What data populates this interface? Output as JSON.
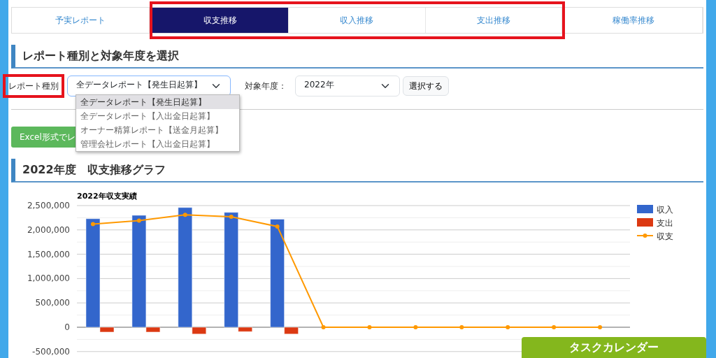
{
  "tabs": [
    {
      "label": "予実レポート",
      "selected": false,
      "highlighted": false
    },
    {
      "label": "収支推移",
      "selected": true,
      "highlighted": true
    },
    {
      "label": "収入推移",
      "selected": false,
      "highlighted": true
    },
    {
      "label": "支出推移",
      "selected": false,
      "highlighted": true
    },
    {
      "label": "稼働率推移",
      "selected": false,
      "highlighted": false
    }
  ],
  "selection_section": {
    "heading": "レポート種別と対象年度を選択",
    "report_type": {
      "label": "レポート種別",
      "highlighted": true,
      "value": "全データレポート【発生日起算】",
      "expanded": true,
      "options": [
        {
          "label": "全データレポート【発生日起算】",
          "selected": true
        },
        {
          "label": "全データレポート【入出金日起算】",
          "selected": false
        },
        {
          "label": "オーナー精算レポート【送金月起算】",
          "selected": false
        },
        {
          "label": "管理会社レポート【入出金日起算】",
          "selected": false
        }
      ]
    },
    "year": {
      "label": "対象年度：",
      "value": "2022年"
    },
    "submit_button": "選択する"
  },
  "excel_button": "Excel形式でレ",
  "graph_section": {
    "heading": "2022年度　収支推移グラフ",
    "chart_data": {
      "type": "bar",
      "title": "2022年収支実績",
      "grid": true,
      "legend": true,
      "series": [
        {
          "name": "収入",
          "color": "#3366cc",
          "type": "bar",
          "values": [
            2230000,
            2300000,
            2460000,
            2360000,
            2220000,
            null,
            null,
            null,
            null,
            null,
            null,
            null
          ]
        },
        {
          "name": "支出",
          "color": "#dc3912",
          "type": "bar",
          "values": [
            -100000,
            -100000,
            -140000,
            -90000,
            -140000,
            null,
            null,
            null,
            null,
            null,
            null,
            null
          ]
        },
        {
          "name": "収支",
          "color": "#ff9900",
          "type": "line",
          "marker": "circle",
          "values": [
            2120000,
            2190000,
            2310000,
            2270000,
            2070000,
            0,
            0,
            0,
            0,
            0,
            0,
            0
          ]
        }
      ],
      "ylim": [
        -500000,
        2500000
      ],
      "yticks": [
        {
          "value": 2500000,
          "label": "2,500,000"
        },
        {
          "value": 2000000,
          "label": "2,000,000"
        },
        {
          "value": 1500000,
          "label": "1,500,000"
        },
        {
          "value": 1000000,
          "label": "1,000,000"
        },
        {
          "value": 500000,
          "label": "500,000"
        },
        {
          "value": 0,
          "label": "0"
        },
        {
          "value": -500000,
          "label": "-500,000"
        }
      ]
    }
  },
  "task_calendar_button": "タスクカレンダー"
}
